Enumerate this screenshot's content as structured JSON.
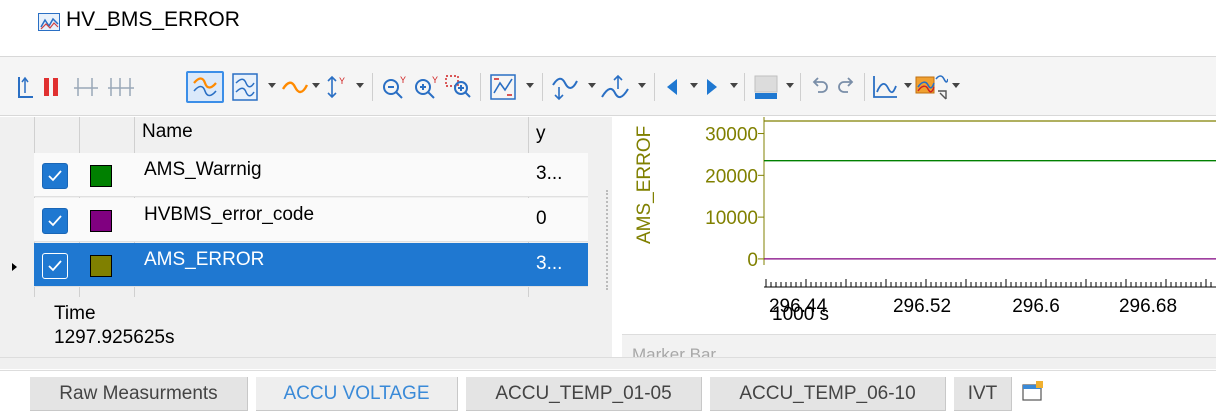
{
  "window": {
    "title": "HV_BMS_ERROR",
    "icon": "graphics-window-icon"
  },
  "toolbar": {
    "buttons": [
      {
        "name": "cursor-mode-icon"
      },
      {
        "name": "pause-icon"
      },
      {
        "name": "measurement-cursor-icon"
      },
      {
        "name": "difference-cursor-icon"
      },
      {
        "name": "signal-view-icon",
        "selected": true
      },
      {
        "name": "signal-layout-icon",
        "selected": true
      },
      {
        "name": "line-type-icon"
      },
      {
        "name": "y-axis-mode-icon"
      },
      {
        "name": "zoom-out-y-icon"
      },
      {
        "name": "zoom-in-y-icon"
      },
      {
        "name": "zoom-area-icon"
      },
      {
        "name": "fit-all-icon"
      },
      {
        "name": "signal-jump-icon"
      },
      {
        "name": "measurement-point-icon"
      },
      {
        "name": "navigate-left-icon"
      },
      {
        "name": "navigate-right-icon"
      },
      {
        "name": "background-color-icon"
      },
      {
        "name": "undo-icon"
      },
      {
        "name": "redo-icon"
      },
      {
        "name": "chart-options-icon"
      },
      {
        "name": "export-icon"
      }
    ],
    "colors": {
      "pause": "#e03030",
      "accent": "#1f78d1",
      "signal": "#ff8a00"
    }
  },
  "signal_list": {
    "columns": {
      "name": "Name",
      "y": "y"
    },
    "rows": [
      {
        "name": "AMS_Warrnig",
        "y": "3...",
        "color": "#008000",
        "checked": true,
        "selected": false
      },
      {
        "name": "HVBMS_error_code",
        "y": "0",
        "color": "#800080",
        "checked": true,
        "selected": false
      },
      {
        "name": "AMS_ERROR",
        "y": "3...",
        "color": "#808000",
        "checked": true,
        "selected": true
      }
    ],
    "time_label": "Time",
    "time_value": "1297.925625s"
  },
  "chart_data": {
    "type": "line",
    "ylabel": "AMS_ERROF",
    "yticks": [
      "30000",
      "20000",
      "10000",
      "0"
    ],
    "xticks": [
      "296.44",
      "296.52",
      "296.6",
      "296.68"
    ],
    "x_unit": "1000 s",
    "ylim": [
      -500,
      33000
    ],
    "series": [
      {
        "name": "AMS_ERROR",
        "color": "#808000",
        "values": [
          33000,
          33000
        ]
      },
      {
        "name": "AMS_Warrnig",
        "color": "#008000",
        "values": [
          23500,
          23500
        ]
      },
      {
        "name": "HVBMS_error_code",
        "color": "#800080",
        "values": [
          0,
          0
        ]
      }
    ]
  },
  "marker_bar": {
    "label": "Marker Bar"
  },
  "tabs": [
    {
      "label": "Raw Measurments",
      "active": false
    },
    {
      "label": "ACCU VOLTAGE",
      "active": true
    },
    {
      "label": "ACCU_TEMP_01-05",
      "active": false
    },
    {
      "label": "ACCU_TEMP_06-10",
      "active": false
    },
    {
      "label": "IVT",
      "active": false
    }
  ]
}
